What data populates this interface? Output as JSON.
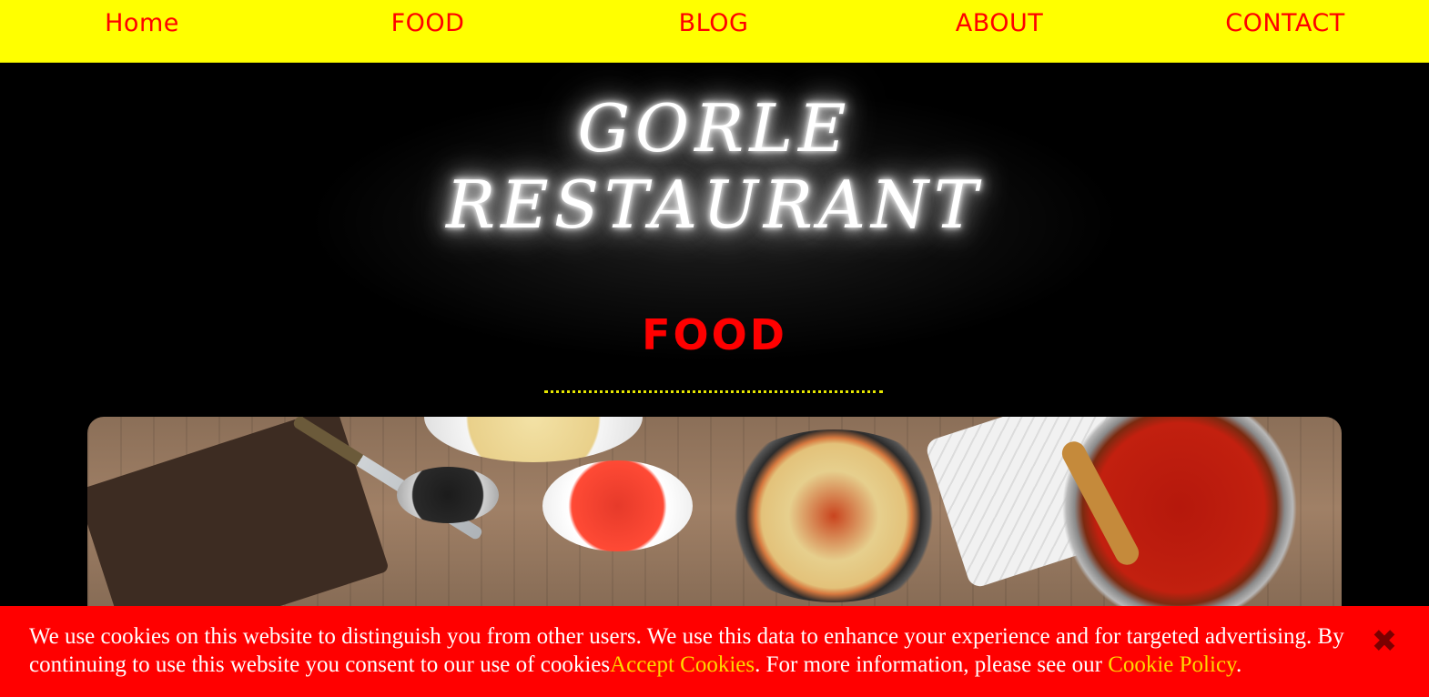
{
  "nav": {
    "items": [
      {
        "label": "Home"
      },
      {
        "label": "FOOD"
      },
      {
        "label": "BLOG"
      },
      {
        "label": "ABOUT"
      },
      {
        "label": "CONTACT"
      }
    ]
  },
  "hero": {
    "title_line1": "GORLE",
    "title_line2": "RESTAURANT",
    "section_title": "FOOD"
  },
  "cookie_banner": {
    "text_part1": "We use cookies on this website to distinguish you from other users. We use this data to enhance your experience and for targeted advertising. By continuing to use this website you consent to our use of cookies",
    "accept_link": "Accept Cookies",
    "text_part2": ". For more information, please see our ",
    "policy_link": "Cookie Policy",
    "text_part3": ".",
    "close_icon": "close-icon"
  },
  "colors": {
    "nav_bg": "#ffff00",
    "nav_text": "#ff0000",
    "cookie_bg": "#ff0000",
    "link_color": "#ffd700"
  }
}
